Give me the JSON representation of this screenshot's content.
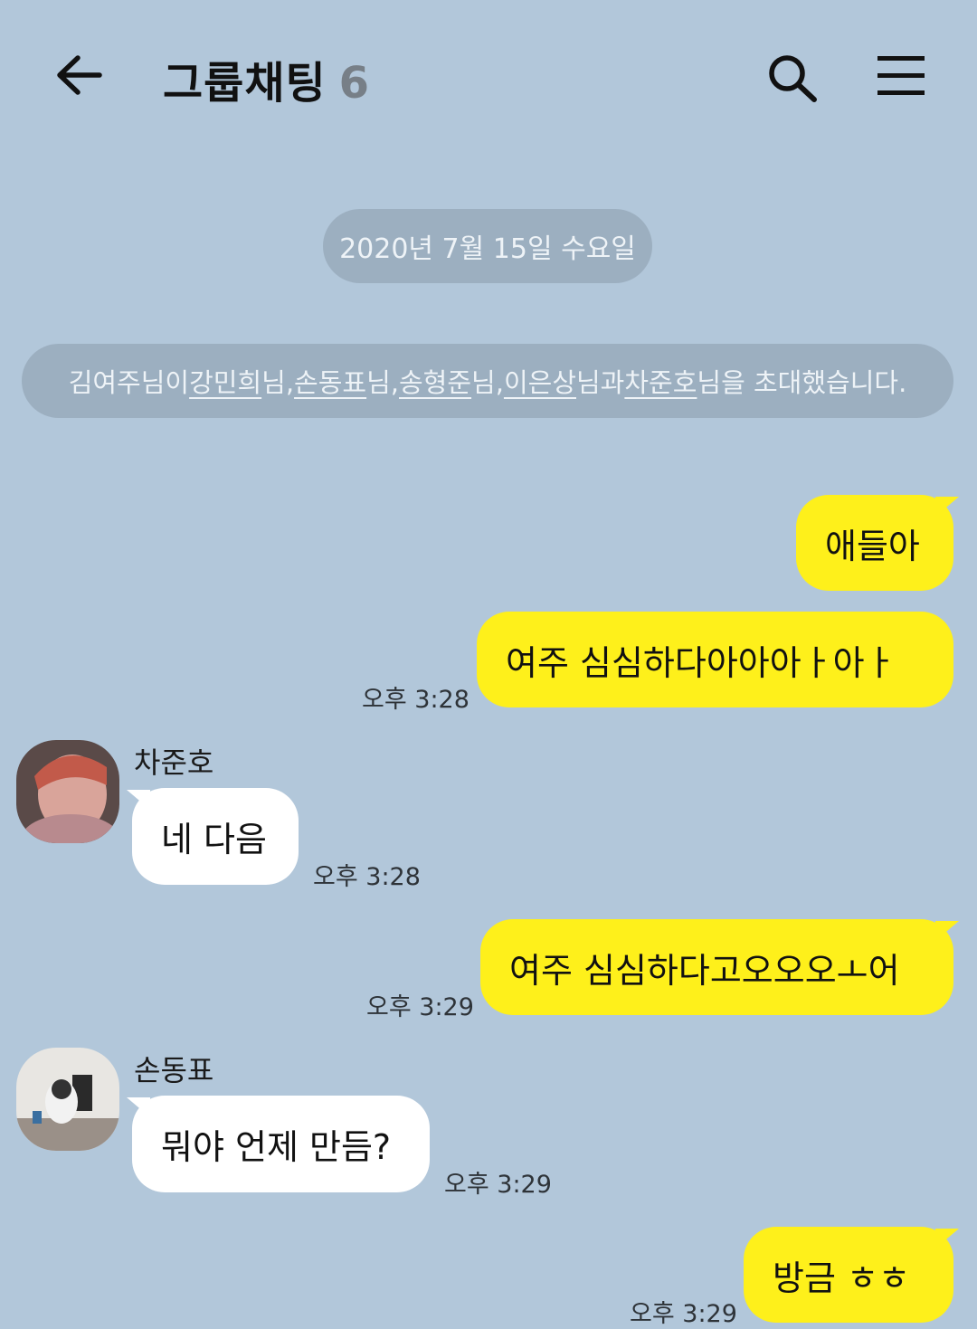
{
  "header": {
    "title": "그룹채팅",
    "member_count": "6",
    "icons": [
      "back-arrow-icon",
      "search-icon",
      "menu-icon"
    ]
  },
  "date_divider": "2020년 7월 15일 수요일",
  "system_message": {
    "parts": [
      "김여주님이 ",
      "강민희",
      "님, ",
      "손동표",
      "님, ",
      "송형준",
      "님, ",
      "이은상",
      "님과 ",
      "차준호",
      "님을 초대했습니다."
    ]
  },
  "messages": [
    {
      "from": "me",
      "text": "애들아"
    },
    {
      "from": "me",
      "text": "여주 심심하다아아아ㅏ아ㅏ",
      "time": "오후 3:28"
    },
    {
      "from": "차준호",
      "text": "네 다음",
      "time": "오후 3:28"
    },
    {
      "from": "me",
      "text": "여주 심심하다고오오오ㅗ어",
      "time": "오후 3:29"
    },
    {
      "from": "손동표",
      "text": "뭐야 언제 만듬?",
      "time": "오후 3:29"
    },
    {
      "from": "me",
      "text": "방금 ㅎㅎ",
      "time": "오후 3:29"
    }
  ],
  "colors": {
    "background": "#b2c7da",
    "my_bubble": "#fef01b",
    "other_bubble": "#ffffff",
    "pill": "#9cafc0"
  }
}
